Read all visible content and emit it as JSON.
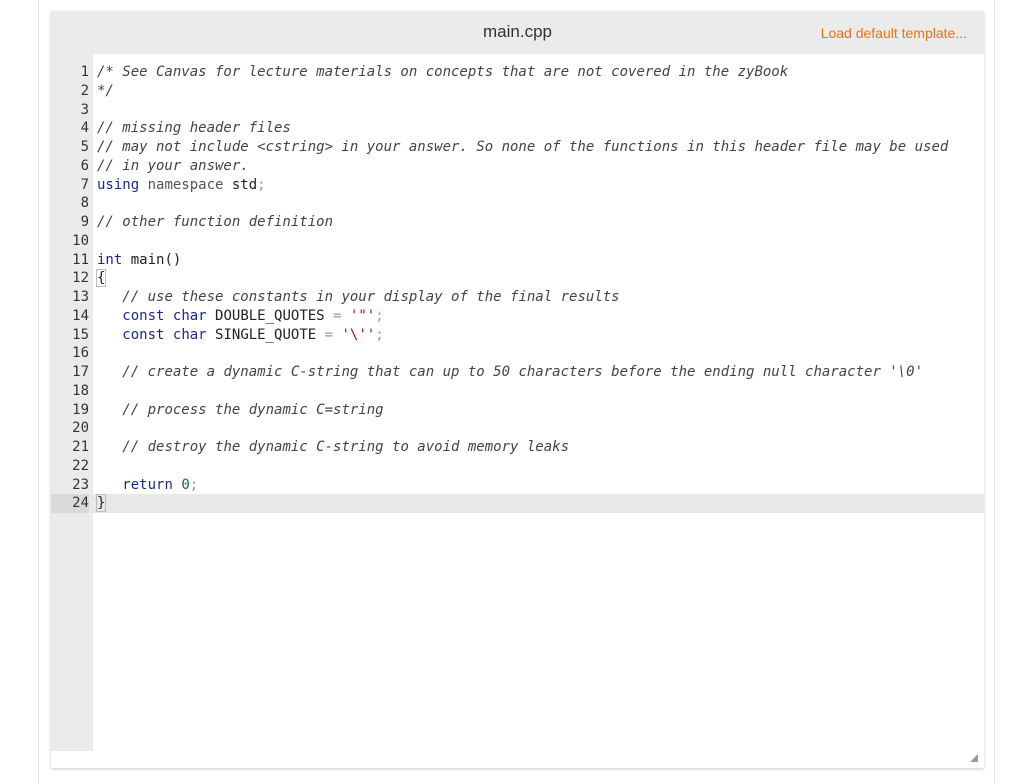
{
  "editor": {
    "file_name": "main.cpp",
    "load_template_label": "Load default template...",
    "active_line": 24
  },
  "code_lines": [
    {
      "n": "1",
      "tokens": [
        {
          "t": "/* See Canvas for lecture materials on concepts that are not covered in the zyBook",
          "c": "comment"
        }
      ]
    },
    {
      "n": "2",
      "tokens": [
        {
          "t": "*/",
          "c": "comment"
        }
      ]
    },
    {
      "n": "3",
      "tokens": []
    },
    {
      "n": "4",
      "tokens": [
        {
          "t": "// missing header files",
          "c": "comment"
        }
      ]
    },
    {
      "n": "5",
      "tokens": [
        {
          "t": "// may not include <cstring> in your answer. So none of the functions in this header file may be used",
          "c": "comment"
        }
      ]
    },
    {
      "n": "6",
      "tokens": [
        {
          "t": "// in your answer.",
          "c": "comment"
        }
      ]
    },
    {
      "n": "7",
      "tokens": [
        {
          "t": "using",
          "c": "kw"
        },
        {
          "t": " ",
          "c": ""
        },
        {
          "t": "namespace",
          "c": "ns"
        },
        {
          "t": " std",
          "c": ""
        },
        {
          "t": ";",
          "c": "punct"
        }
      ]
    },
    {
      "n": "8",
      "tokens": []
    },
    {
      "n": "9",
      "tokens": [
        {
          "t": "// other function definition",
          "c": "comment"
        }
      ]
    },
    {
      "n": "10",
      "tokens": []
    },
    {
      "n": "11",
      "tokens": [
        {
          "t": "int",
          "c": "type"
        },
        {
          "t": " main()",
          "c": ""
        }
      ]
    },
    {
      "n": "12",
      "tokens": [
        {
          "t": "{",
          "c": "brace"
        }
      ]
    },
    {
      "n": "13",
      "tokens": [
        {
          "t": "   ",
          "c": ""
        },
        {
          "t": "// use these constants in your display of the final results",
          "c": "comment"
        }
      ]
    },
    {
      "n": "14",
      "tokens": [
        {
          "t": "   ",
          "c": ""
        },
        {
          "t": "const",
          "c": "kw"
        },
        {
          "t": " ",
          "c": ""
        },
        {
          "t": "char",
          "c": "type"
        },
        {
          "t": " DOUBLE_QUOTES ",
          "c": ""
        },
        {
          "t": "=",
          "c": "punct"
        },
        {
          "t": " ",
          "c": ""
        },
        {
          "t": "'\"'",
          "c": "str"
        },
        {
          "t": ";",
          "c": "punct"
        }
      ]
    },
    {
      "n": "15",
      "tokens": [
        {
          "t": "   ",
          "c": ""
        },
        {
          "t": "const",
          "c": "kw"
        },
        {
          "t": " ",
          "c": ""
        },
        {
          "t": "char",
          "c": "type"
        },
        {
          "t": " SINGLE_QUOTE ",
          "c": ""
        },
        {
          "t": "=",
          "c": "punct"
        },
        {
          "t": " ",
          "c": ""
        },
        {
          "t": "'\\''",
          "c": "str"
        },
        {
          "t": ";",
          "c": "punct"
        }
      ]
    },
    {
      "n": "16",
      "tokens": []
    },
    {
      "n": "17",
      "tokens": [
        {
          "t": "   ",
          "c": ""
        },
        {
          "t": "// create a dynamic C-string that can up to 50 characters before the ending null character '\\0'",
          "c": "comment"
        }
      ]
    },
    {
      "n": "18",
      "tokens": []
    },
    {
      "n": "19",
      "tokens": [
        {
          "t": "   ",
          "c": ""
        },
        {
          "t": "// process the dynamic C=string",
          "c": "comment"
        }
      ]
    },
    {
      "n": "20",
      "tokens": []
    },
    {
      "n": "21",
      "tokens": [
        {
          "t": "   ",
          "c": ""
        },
        {
          "t": "// destroy the dynamic C-string to avoid memory leaks",
          "c": "comment"
        }
      ]
    },
    {
      "n": "22",
      "tokens": []
    },
    {
      "n": "23",
      "tokens": [
        {
          "t": "   ",
          "c": ""
        },
        {
          "t": "return",
          "c": "kw"
        },
        {
          "t": " ",
          "c": ""
        },
        {
          "t": "0",
          "c": "num"
        },
        {
          "t": ";",
          "c": "punct"
        }
      ]
    },
    {
      "n": "24",
      "tokens": [
        {
          "t": "}",
          "c": "brace"
        }
      ]
    }
  ],
  "colors": {
    "accent_link": "#e8750a",
    "header_bg": "#ebebeb",
    "keyword": "#1a2a8a",
    "string": "#a11",
    "number": "#116644"
  },
  "icons": {
    "resize": "resize-grip-icon"
  }
}
